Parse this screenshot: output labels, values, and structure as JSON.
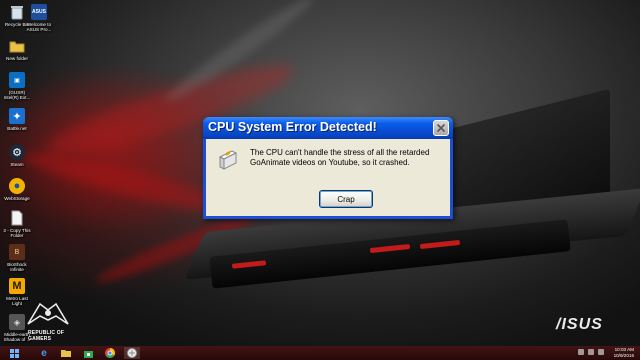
{
  "desktop": {
    "icons": [
      {
        "label": "Recycle Bin",
        "icon": "recycle-bin-icon"
      },
      {
        "label": "Welcome to ASUS Pro...",
        "icon": "asus-welcome-icon"
      },
      {
        "label": "New folder",
        "icon": "folder-icon"
      },
      {
        "label": "(GUSR) Intel(R) Ext...",
        "icon": "intel-icon"
      },
      {
        "label": "Battle.net",
        "icon": "battlenet-icon"
      },
      {
        "label": "Steam",
        "icon": "steam-icon"
      },
      {
        "label": "WebStorage",
        "icon": "webstorage-icon"
      },
      {
        "label": "3 - Copy This Folder",
        "icon": "document-icon"
      },
      {
        "label": "BioShock Infinite",
        "icon": "bioshock-icon"
      },
      {
        "label": "Metro Last Light",
        "icon": "metro-icon"
      },
      {
        "label": "Middle-earth Shadow of ...",
        "icon": "middle-earth-icon"
      }
    ],
    "rog_text": "REPUBLIC OF\nGAMERS",
    "asus_logo": "/ISUS"
  },
  "dialog": {
    "title": "CPU System Error Detected!",
    "message": "The CPU can't handle the stress of all the retarded GoAnimate videos on Youtube, so it crashed.",
    "button_label": "Crap",
    "close_icon": "close-icon",
    "message_icon": "cpu-chip-icon"
  },
  "taskbar": {
    "buttons": [
      "windows-start-icon",
      "internet-explorer-icon",
      "file-explorer-icon",
      "windows-store-icon",
      "chrome-icon",
      "goanimate-icon"
    ],
    "time": "10:03 AM",
    "date": "10/9/2016"
  },
  "colors": {
    "titlebar_blue": "#0a5be8",
    "dialog_face": "#ece9d8",
    "wallpaper_red": "#c31a1a"
  }
}
